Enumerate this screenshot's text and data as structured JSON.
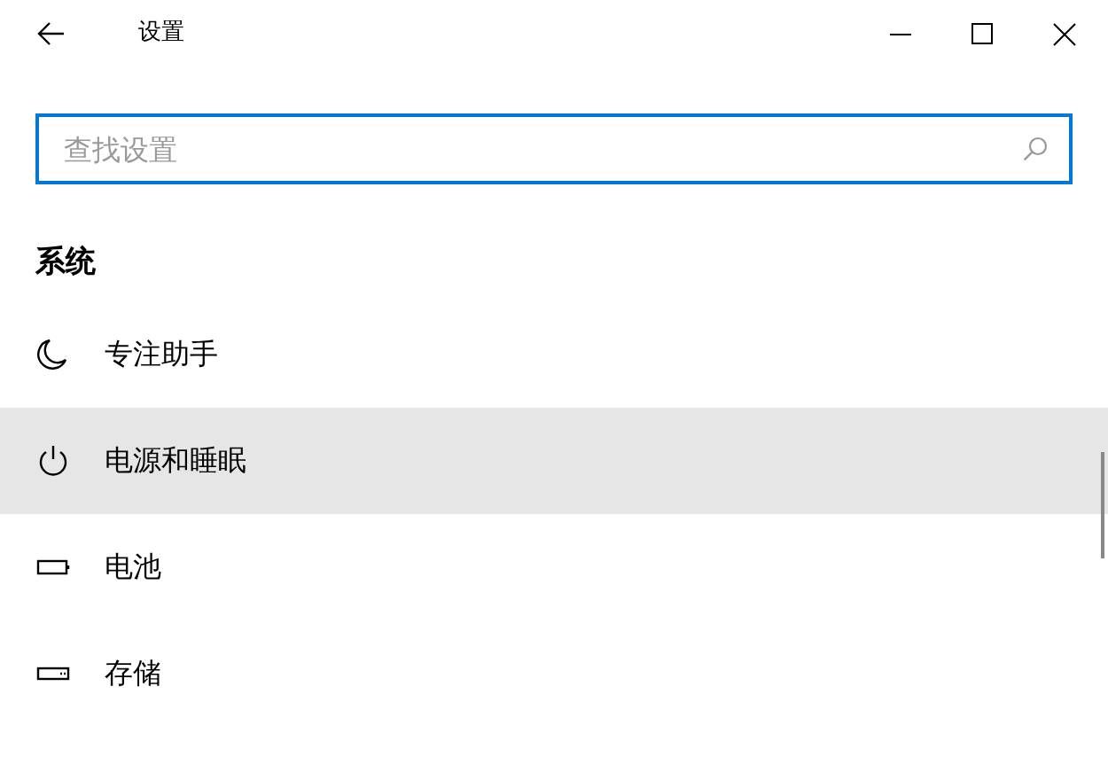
{
  "window": {
    "title": "设置"
  },
  "search": {
    "placeholder": "查找设置"
  },
  "section": "系统",
  "items": [
    {
      "kind": "moon",
      "label": "专注助手",
      "selected": false
    },
    {
      "kind": "power",
      "label": "电源和睡眠",
      "selected": true
    },
    {
      "kind": "battery",
      "label": "电池",
      "selected": false
    },
    {
      "kind": "storage",
      "label": "存储",
      "selected": false
    }
  ]
}
